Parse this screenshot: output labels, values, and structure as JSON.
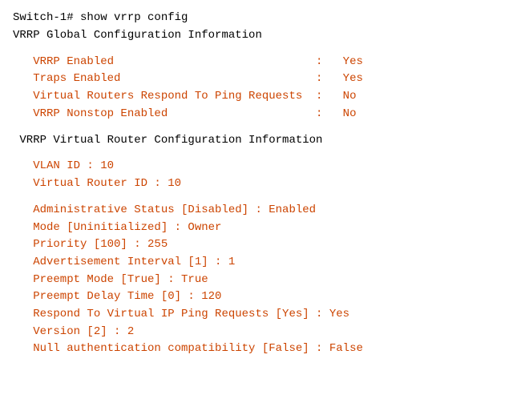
{
  "terminal": {
    "lines": [
      {
        "text": "Switch-1# show vrrp config",
        "style": "black"
      },
      {
        "text": "VRRP Global Configuration Information",
        "style": "black"
      },
      {
        "text": "",
        "style": "spacer"
      },
      {
        "text": "   VRRP Enabled                              :   Yes",
        "style": "orange"
      },
      {
        "text": "   Traps Enabled                             :   Yes",
        "style": "orange"
      },
      {
        "text": "   Virtual Routers Respond To Ping Requests  :   No",
        "style": "orange"
      },
      {
        "text": "   VRRP Nonstop Enabled                      :   No",
        "style": "orange"
      },
      {
        "text": "",
        "style": "spacer"
      },
      {
        "text": " VRRP Virtual Router Configuration Information",
        "style": "black"
      },
      {
        "text": "",
        "style": "spacer"
      },
      {
        "text": "   VLAN ID : 10",
        "style": "orange"
      },
      {
        "text": "   Virtual Router ID : 10",
        "style": "orange"
      },
      {
        "text": "",
        "style": "spacer"
      },
      {
        "text": "   Administrative Status [Disabled] : Enabled",
        "style": "orange"
      },
      {
        "text": "   Mode [Uninitialized] : Owner",
        "style": "orange"
      },
      {
        "text": "   Priority [100] : 255",
        "style": "orange"
      },
      {
        "text": "   Advertisement Interval [1] : 1",
        "style": "orange"
      },
      {
        "text": "   Preempt Mode [True] : True",
        "style": "orange"
      },
      {
        "text": "   Preempt Delay Time [0] : 120",
        "style": "orange"
      },
      {
        "text": "   Respond To Virtual IP Ping Requests [Yes] : Yes",
        "style": "orange"
      },
      {
        "text": "   Version [2] : 2",
        "style": "orange"
      },
      {
        "text": "   Null authentication compatibility [False] : False",
        "style": "orange"
      }
    ]
  }
}
